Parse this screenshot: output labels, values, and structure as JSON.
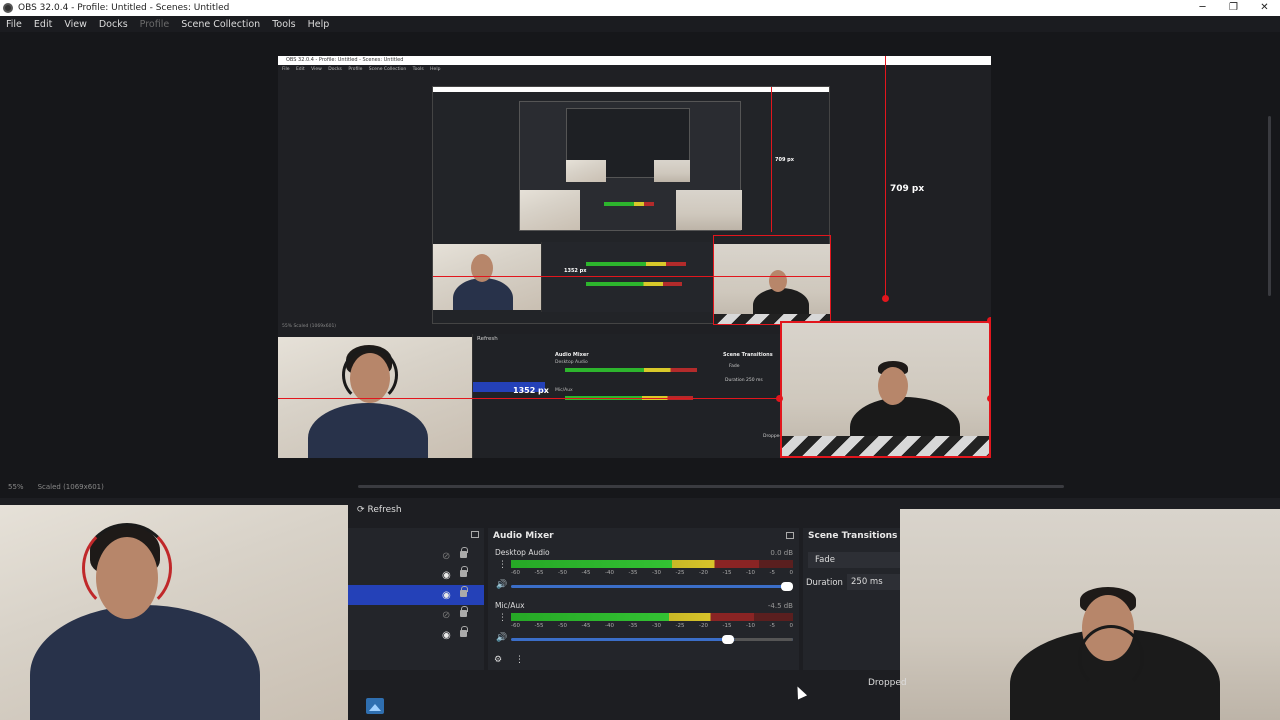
{
  "window": {
    "title": "OBS 32.0.4 - Profile: Untitled - Scenes: Untitled",
    "controls": [
      "─",
      "❐",
      "✕"
    ]
  },
  "menu": {
    "items": [
      "File",
      "Edit",
      "View",
      "Docks",
      "Profile",
      "Scene Collection",
      "Tools",
      "Help"
    ]
  },
  "preview": {
    "nested_title": "OBS 32.0.4 - Profile: Untitled - Scenes: Untitled",
    "height_label": "709 px",
    "width_label": "1352 px",
    "inner_height_label": "709 px",
    "inner_width_label": "1352 px",
    "mini_refresh": "Refresh",
    "mini_audio_mixer": "Audio Mixer",
    "mini_scene_transitions": "Scene Transitions",
    "mini_desktop_audio": "Desktop Audio",
    "mini_mic": "Mic/Aux",
    "mini_fade": "Fade",
    "mini_duration": "Duration",
    "mini_duration_value": "250 ms",
    "mini_dropped": "Dropped"
  },
  "status": {
    "zoom": "55%",
    "scale": "Scaled (1069x601)"
  },
  "toolbar": {
    "refresh_label": "Refresh"
  },
  "sources": {
    "rows": [
      {
        "visible": false
      },
      {
        "visible": true
      },
      {
        "visible": true,
        "selected": true
      },
      {
        "visible": false
      },
      {
        "visible": true
      }
    ]
  },
  "audio_mixer": {
    "title": "Audio Mixer",
    "ticks": [
      "-60",
      "-55",
      "-50",
      "-45",
      "-40",
      "-35",
      "-30",
      "-25",
      "-20",
      "-15",
      "-10",
      "-5",
      "0"
    ],
    "channels": [
      {
        "name": "Desktop Audio",
        "db": "0.0 dB",
        "level": 0.88,
        "volume": 1.0
      },
      {
        "name": "Mic/Aux",
        "db": "-4.5 dB",
        "level": 0.86,
        "volume": 0.79
      }
    ]
  },
  "scene_transitions": {
    "title": "Scene Transitions",
    "transition": "Fade",
    "duration_label": "Duration",
    "duration_value": "250 ms"
  },
  "footer": {
    "dropped_label": "Dropped"
  },
  "colors": {
    "accent": "#2441b8",
    "guide": "#e2161d",
    "meter_green": "#33c233",
    "meter_yellow": "#d8c42a",
    "meter_red": "#8a2424"
  }
}
